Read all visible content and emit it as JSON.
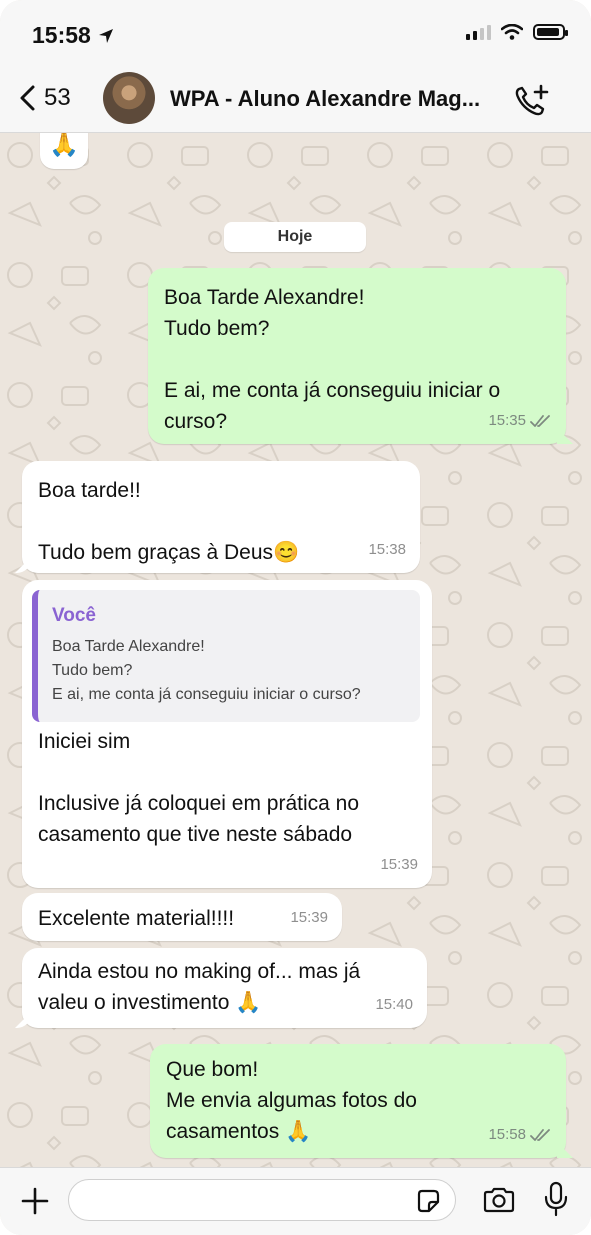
{
  "status_bar": {
    "time": "15:58"
  },
  "header": {
    "back_count": "53",
    "title": "WPA - Aluno Alexandre Mag...",
    "icons": {
      "back": "chevron-left-icon",
      "call": "phone-plus-icon",
      "avatar": "contact-avatar"
    }
  },
  "chat": {
    "top_emoji": "🙏",
    "date_chip": "Hoje",
    "messages": [
      {
        "direction": "out",
        "text": "Boa Tarde Alexandre!\nTudo bem?\n\nE ai, me conta já conseguiu iniciar o curso?",
        "time": "15:35",
        "read": true
      },
      {
        "direction": "in",
        "text": "Boa tarde!!\n\nTudo bem graças à Deus😊",
        "time": "15:38"
      },
      {
        "direction": "in",
        "quote_author": "Você",
        "quote_text": "Boa Tarde Alexandre!\nTudo bem?\nE ai, me conta já conseguiu iniciar o curso?",
        "text": "Iniciei sim\n\nInclusive já coloquei em prática no casamento que tive neste sábado",
        "time": "15:39"
      },
      {
        "direction": "in",
        "text": "Excelente material!!!!",
        "time": "15:39"
      },
      {
        "direction": "in",
        "text": "Ainda estou no making of... mas já valeu o investimento 🙏",
        "time": "15:40"
      },
      {
        "direction": "out",
        "text": "Que bom!\nMe envia algumas fotos do casamentos 🙏",
        "time": "15:58",
        "read": true
      }
    ]
  },
  "composer": {
    "input_value": "",
    "icons": {
      "attach": "plus-icon",
      "sticker": "sticker-icon",
      "camera": "camera-icon",
      "mic": "microphone-icon"
    }
  },
  "colors": {
    "outgoing": "#d4fbcb",
    "incoming": "#ffffff",
    "background": "#ece5dd",
    "quote_accent": "#8a63d2",
    "read_ticks": "#7d8a80"
  }
}
